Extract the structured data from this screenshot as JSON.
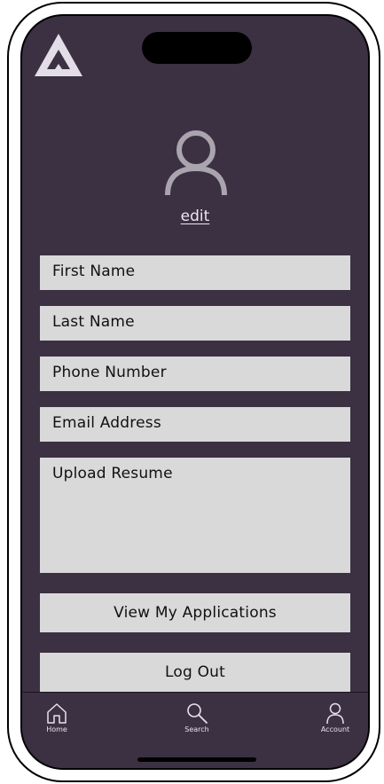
{
  "profile": {
    "edit_label": "edit",
    "fields": [
      {
        "placeholder": "First Name",
        "value": ""
      },
      {
        "placeholder": "Last Name",
        "value": ""
      },
      {
        "placeholder": "Phone Number",
        "value": ""
      },
      {
        "placeholder": "Email Address",
        "value": ""
      },
      {
        "placeholder": "Upload Resume",
        "value": ""
      }
    ]
  },
  "actions": {
    "view_applications": "View My Applications",
    "log_out": "Log Out"
  },
  "tabbar": {
    "items": [
      {
        "label": "Home",
        "icon": "home-icon"
      },
      {
        "label": "Search",
        "icon": "search-icon"
      },
      {
        "label": "Account",
        "icon": "account-icon"
      }
    ]
  },
  "colors": {
    "screen_bg": "#3b3142",
    "field_bg": "#d9d9d9",
    "text_light": "#ece6f2"
  }
}
